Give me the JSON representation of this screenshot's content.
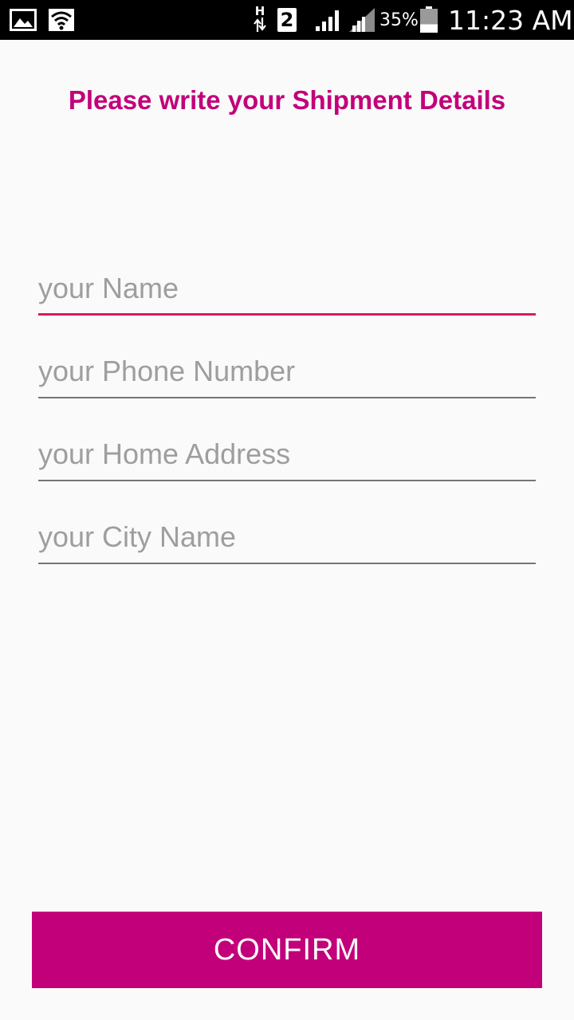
{
  "status_bar": {
    "network_type": "H",
    "sim_slot": "2",
    "battery_percent": "35%",
    "time": "11:23 AM",
    "battery_level": 0.35,
    "icons": [
      "gallery-icon",
      "wifi-icon",
      "data-arrows-icon",
      "signal-icon",
      "signal-icon",
      "battery-icon"
    ]
  },
  "header": {
    "title": "Please write your Shipment Details"
  },
  "form": {
    "fields": [
      {
        "placeholder": "your Name",
        "value": ""
      },
      {
        "placeholder": "your Phone Number",
        "value": ""
      },
      {
        "placeholder": "your Home Address",
        "value": ""
      },
      {
        "placeholder": "your City Name",
        "value": ""
      }
    ],
    "confirm_label": "CONFIRM"
  },
  "colors": {
    "accent": "#c2007a",
    "focus_underline": "#d81b60",
    "underline": "#757575",
    "placeholder": "#9e9e9e",
    "background": "#fafafa",
    "status_bar": "#000000"
  }
}
